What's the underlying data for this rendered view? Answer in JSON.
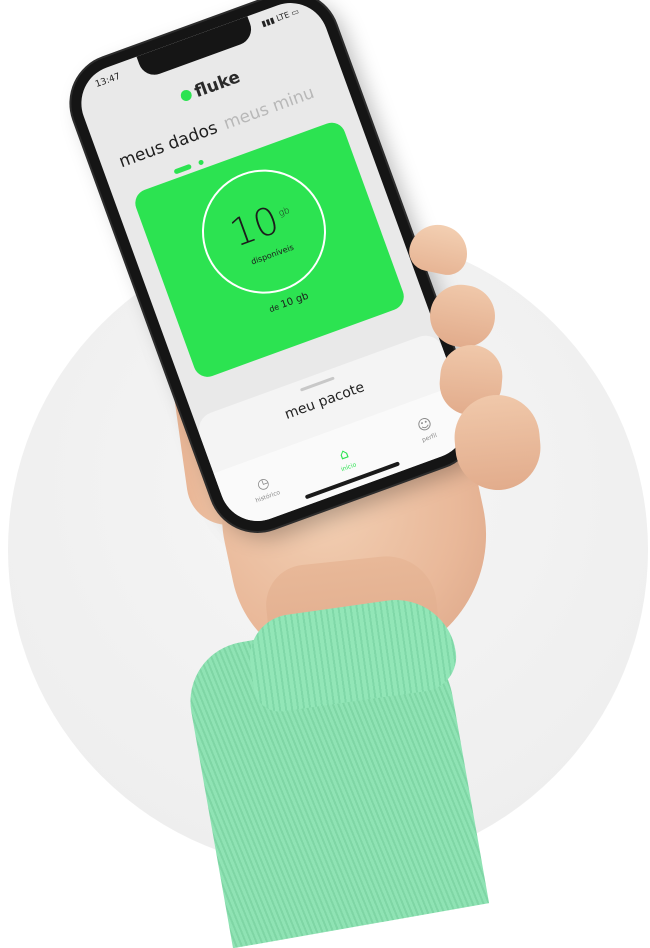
{
  "status_bar": {
    "time": "13:47",
    "network": "LTE"
  },
  "app": {
    "brand": "fluke",
    "accent": "#2ce351"
  },
  "tabs": {
    "active": "meus dados",
    "inactive": "meus minu"
  },
  "usage": {
    "amount": "10",
    "unit": "gb",
    "available_label": "disponíveis",
    "total_prefix": "de",
    "total_value": "10 gb"
  },
  "sheet": {
    "title": "meu pacote"
  },
  "bottom_nav": {
    "history": "histórico",
    "home": "início",
    "profile": "perfil"
  }
}
